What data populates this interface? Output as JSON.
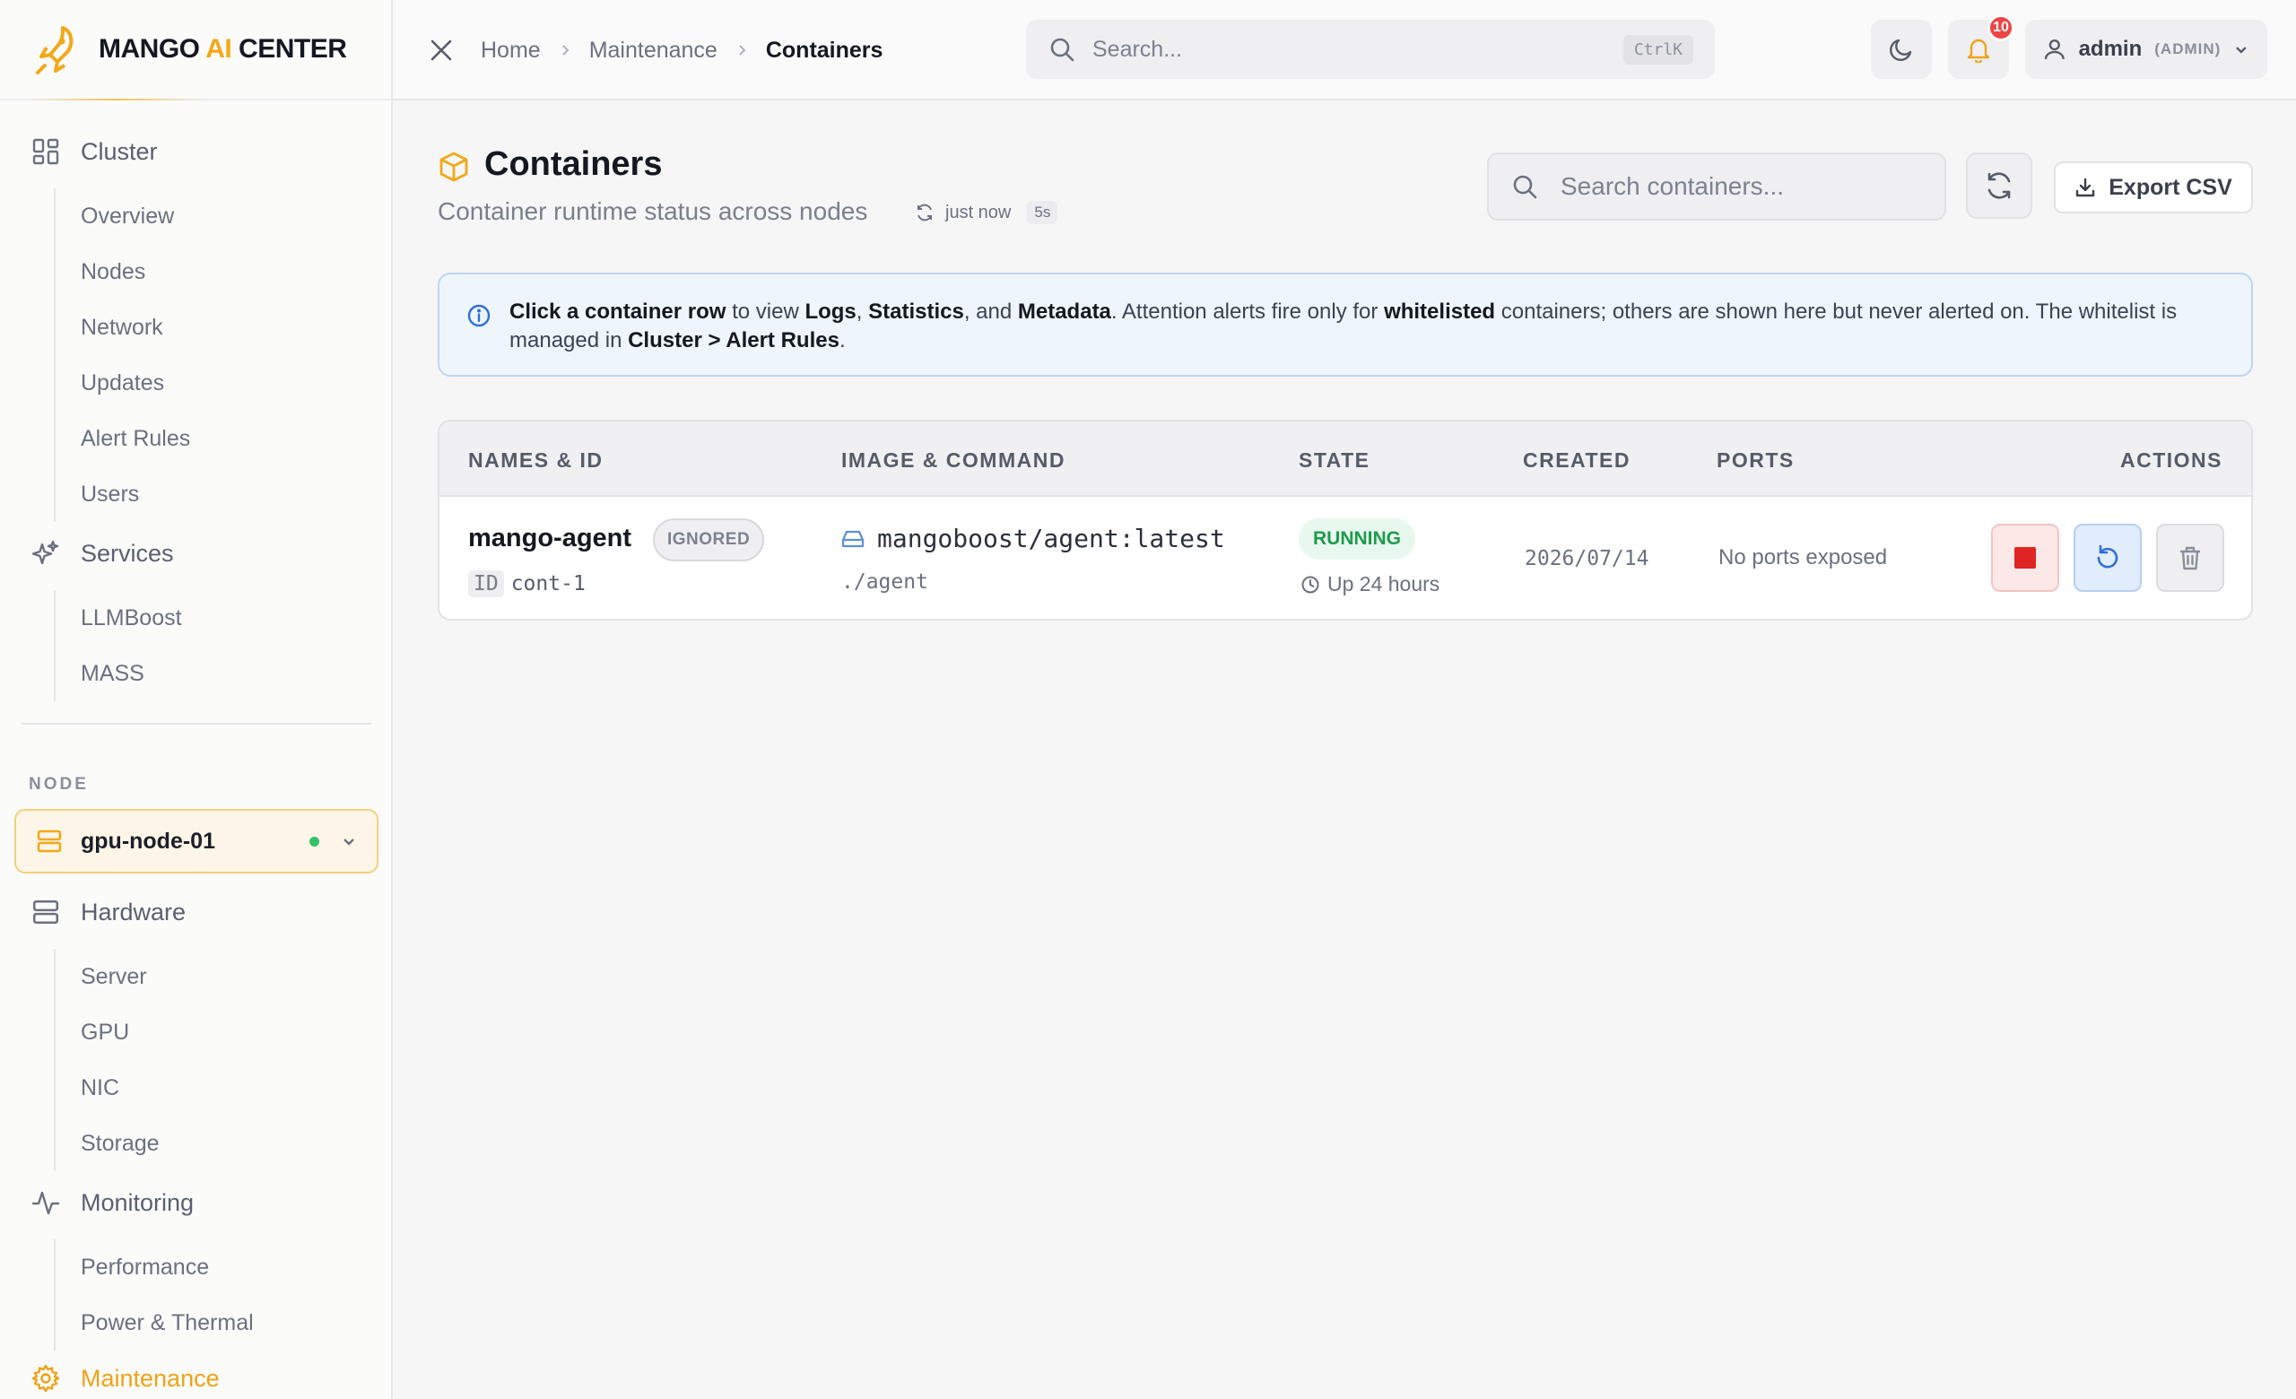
{
  "brand": {
    "name_part1": "MANGO ",
    "name_ai": "AI",
    "name_part2": " CENTER"
  },
  "sidebar": {
    "cluster": {
      "label": "Cluster",
      "items": [
        "Overview",
        "Nodes",
        "Network",
        "Updates",
        "Alert Rules",
        "Users"
      ]
    },
    "services": {
      "label": "Services",
      "items": [
        "LLMBoost",
        "MASS"
      ]
    },
    "node_section_label": "NODE",
    "node_select": {
      "value": "gpu-node-01"
    },
    "hardware": {
      "label": "Hardware",
      "items": [
        "Server",
        "GPU",
        "NIC",
        "Storage"
      ]
    },
    "monitoring": {
      "label": "Monitoring",
      "items": [
        "Performance",
        "Power & Thermal"
      ]
    },
    "maintenance": {
      "label": "Maintenance"
    }
  },
  "topbar": {
    "breadcrumbs": [
      "Home",
      "Maintenance",
      "Containers"
    ],
    "search_placeholder": "Search...",
    "search_shortcut": "CtrlK",
    "notifications_count": "10",
    "user": {
      "name": "admin",
      "role": "(ADMIN)"
    }
  },
  "page": {
    "title": "Containers",
    "subtitle": "Container runtime status across nodes",
    "refreshed": "just now",
    "refresh_interval": "5s",
    "search_placeholder": "Search containers...",
    "export_label": "Export CSV"
  },
  "info": {
    "t1": "Click a container row",
    "t2": " to view ",
    "t3": "Logs",
    "t4": ", ",
    "t5": "Statistics",
    "t6": ", and ",
    "t7": "Metadata",
    "t8": ". Attention alerts fire only for ",
    "t9": "whitelisted",
    "t10": " containers; others are shown here but never alerted on. The whitelist is managed in ",
    "t11": "Cluster > Alert Rules",
    "t12": "."
  },
  "table": {
    "headers": {
      "names": "NAMES & ID",
      "image": "IMAGE & COMMAND",
      "state": "STATE",
      "created": "CREATED",
      "ports": "PORTS",
      "actions": "ACTIONS"
    },
    "rows": [
      {
        "name": "mango-agent",
        "tag": "IGNORED",
        "id_label": "ID",
        "id": "cont-1",
        "image": "mangoboost/agent:latest",
        "command": "./agent",
        "state": "RUNNING",
        "uptime": "Up 24 hours",
        "created": "2026/07/14",
        "ports": "No ports exposed"
      }
    ]
  },
  "colors": {
    "accent": "#f2a818",
    "running": "#1f9a4e",
    "danger": "#e02424",
    "info": "#2f6fd6"
  }
}
